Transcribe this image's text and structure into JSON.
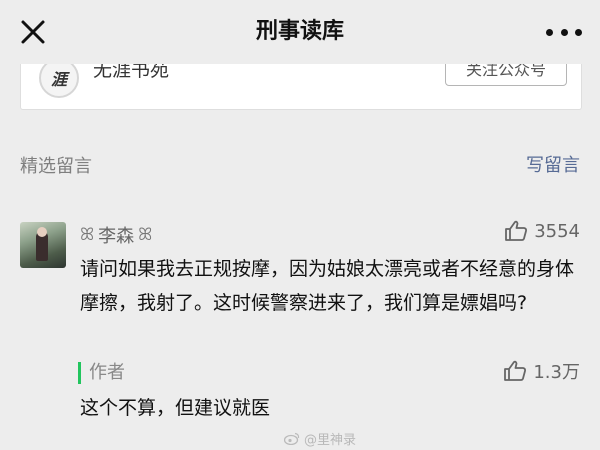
{
  "nav": {
    "title": "刑事读库",
    "close_icon": "close-icon",
    "more_icon": "more-dots-icon"
  },
  "account": {
    "avatar_char": "涯",
    "name": "无涯书苑",
    "follow_label": "关注公众号"
  },
  "comments_section": {
    "title": "精选留言",
    "write_label": "写留言"
  },
  "comment": {
    "user": "李森",
    "flourish_left": "ꕤ",
    "flourish_right": "ꕤ",
    "likes": "3554",
    "text": "请问如果我去正规按摩，因为姑娘太漂亮或者不经意的身体摩擦，我射了。这时候警察进来了，我们算是嫖娼吗?",
    "reply": {
      "author_label": "作者",
      "likes": "1.3万",
      "text": "这个不算，但建议就医"
    }
  },
  "watermark": "@里神录",
  "colors": {
    "link": "#576b95",
    "author_bar": "#22c55e",
    "background": "#ededed"
  }
}
